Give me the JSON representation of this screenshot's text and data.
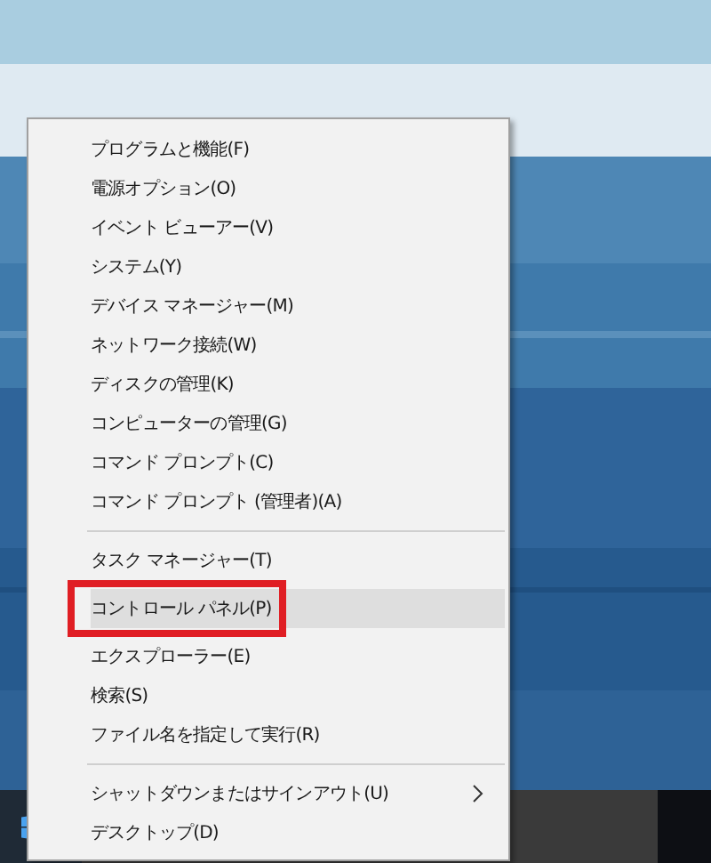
{
  "context_menu": {
    "groups": [
      {
        "items": [
          {
            "label": "プログラムと機能(F)",
            "selected": false,
            "marked": false,
            "submenu": false
          },
          {
            "label": "電源オプション(O)",
            "selected": false,
            "marked": false,
            "submenu": false
          },
          {
            "label": "イベント ビューアー(V)",
            "selected": false,
            "marked": false,
            "submenu": false
          },
          {
            "label": "システム(Y)",
            "selected": false,
            "marked": false,
            "submenu": false
          },
          {
            "label": "デバイス マネージャー(M)",
            "selected": false,
            "marked": false,
            "submenu": false
          },
          {
            "label": "ネットワーク接続(W)",
            "selected": false,
            "marked": false,
            "submenu": false
          },
          {
            "label": "ディスクの管理(K)",
            "selected": false,
            "marked": false,
            "submenu": false
          },
          {
            "label": "コンピューターの管理(G)",
            "selected": false,
            "marked": false,
            "submenu": false
          },
          {
            "label": "コマンド プロンプト(C)",
            "selected": false,
            "marked": false,
            "submenu": false
          },
          {
            "label": "コマンド プロンプト (管理者)(A)",
            "selected": false,
            "marked": false,
            "submenu": false
          }
        ]
      },
      {
        "items": [
          {
            "label": "タスク マネージャー(T)",
            "selected": false,
            "marked": false,
            "submenu": false
          },
          {
            "label": "コントロール パネル(P)",
            "selected": true,
            "marked": true,
            "submenu": false
          },
          {
            "label": "エクスプローラー(E)",
            "selected": false,
            "marked": false,
            "submenu": false
          },
          {
            "label": "検索(S)",
            "selected": false,
            "marked": false,
            "submenu": false
          },
          {
            "label": "ファイル名を指定して実行(R)",
            "selected": false,
            "marked": false,
            "submenu": false
          }
        ]
      },
      {
        "items": [
          {
            "label": "シャットダウンまたはサインアウト(U)",
            "selected": false,
            "marked": false,
            "submenu": true
          },
          {
            "label": "デスクトップ(D)",
            "selected": false,
            "marked": false,
            "submenu": false
          }
        ]
      }
    ]
  }
}
